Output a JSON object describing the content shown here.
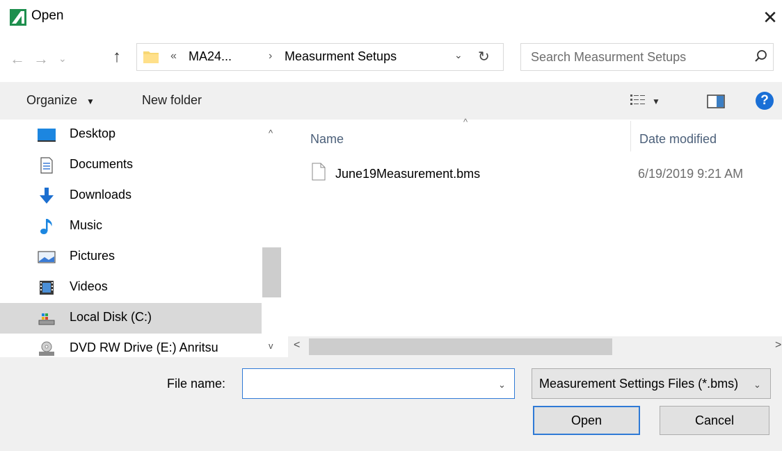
{
  "window": {
    "title": "Open",
    "close_symbol": "✕"
  },
  "address": {
    "crumbs": [
      "MA24...",
      "Measurment Setups"
    ],
    "overflow_marker": "«",
    "separator": "›"
  },
  "search": {
    "placeholder": "Search Measurment Setups"
  },
  "toolbar": {
    "organize_label": "Organize",
    "new_folder_label": "New folder",
    "help_label": "?"
  },
  "nav": {
    "items": [
      {
        "label": "Desktop",
        "icon": "desktop-icon"
      },
      {
        "label": "Documents",
        "icon": "documents-icon"
      },
      {
        "label": "Downloads",
        "icon": "downloads-icon"
      },
      {
        "label": "Music",
        "icon": "music-icon"
      },
      {
        "label": "Pictures",
        "icon": "pictures-icon"
      },
      {
        "label": "Videos",
        "icon": "videos-icon"
      },
      {
        "label": "Local Disk (C:)",
        "icon": "local-disk-icon",
        "selected": true
      },
      {
        "label": "DVD RW Drive (E:) Anritsu",
        "icon": "dvd-drive-icon"
      }
    ]
  },
  "files": {
    "columns": {
      "name": "Name",
      "date": "Date modified"
    },
    "rows": [
      {
        "name": "June19Measurement.bms",
        "date": "6/19/2019 9:21 AM"
      }
    ]
  },
  "bottom": {
    "filename_label": "File name:",
    "filename_value": "",
    "filter_value": "Measurement Settings Files (*.bms)",
    "open_label": "Open",
    "cancel_label": "Cancel"
  },
  "colors": {
    "accent": "#2f7ad6",
    "selected": "#d9d9d9",
    "help": "#1a6fd6",
    "toolbar": "#f0f0f0"
  }
}
